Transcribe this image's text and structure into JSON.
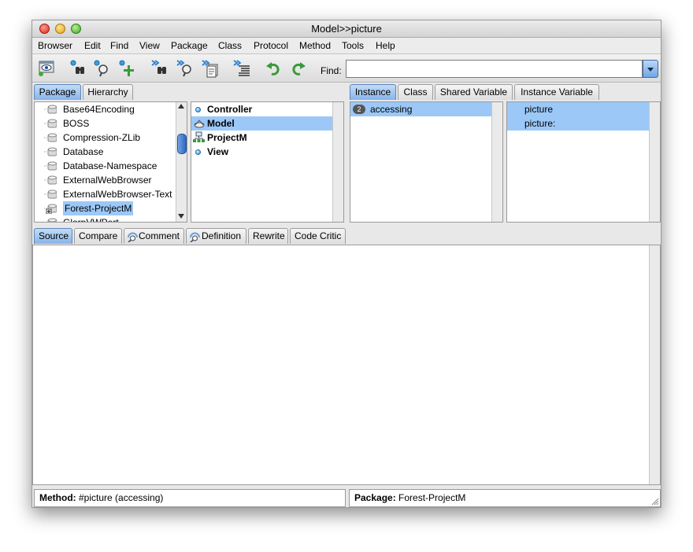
{
  "window": {
    "title": "Model>>picture"
  },
  "menu": [
    "Browser",
    "Edit",
    "Find",
    "View",
    "Package",
    "Class",
    "Protocol",
    "Method",
    "Tools",
    "Help"
  ],
  "toolbar": {
    "buttons": [
      "browse-window-icon",
      "find-class-icon",
      "find-method-icon",
      "add-icon",
      "find-next-class-icon",
      "find-next-method-icon",
      "find-next-source-icon",
      "format-code-icon",
      "undo-icon",
      "redo-icon"
    ],
    "find_label": "Find:",
    "find_value": ""
  },
  "package_tabs": [
    "Package",
    "Hierarchy"
  ],
  "packages": [
    "Base64Encoding",
    "BOSS",
    "Compression-ZLib",
    "Database",
    "Database-Namespace",
    "ExternalWebBrowser",
    "ExternalWebBrowser-Text",
    "Forest-ProjectM",
    "GlorpVWPort"
  ],
  "selected_package": "Forest-ProjectM",
  "classes": [
    {
      "name": "Controller",
      "icon": "class-dot-icon"
    },
    {
      "name": "Model",
      "icon": "model-class-icon",
      "selected": true
    },
    {
      "name": "ProjectM",
      "icon": "hierarchy-class-icon"
    },
    {
      "name": "View",
      "icon": "class-dot-icon"
    }
  ],
  "category_tabs": [
    "Instance",
    "Class",
    "Shared Variable",
    "Instance Variable"
  ],
  "protocols": [
    {
      "count": "2",
      "name": "accessing",
      "selected": true
    }
  ],
  "methods": [
    {
      "name": "picture",
      "selected": true
    },
    {
      "name": "picture:",
      "selected": true
    }
  ],
  "code_tabs": [
    {
      "label": "Source",
      "icon": ""
    },
    {
      "label": "Compare",
      "icon": ""
    },
    {
      "label": "Comment",
      "icon": "comment-magnifier-icon"
    },
    {
      "label": "Definition",
      "icon": "definition-magnifier-icon"
    },
    {
      "label": "Rewrite",
      "icon": ""
    },
    {
      "label": "Code Critic",
      "icon": ""
    }
  ],
  "status": {
    "method_label": "Method:",
    "method_value": "#picture (accessing)",
    "package_label": "Package:",
    "package_value": "Forest-ProjectM"
  }
}
